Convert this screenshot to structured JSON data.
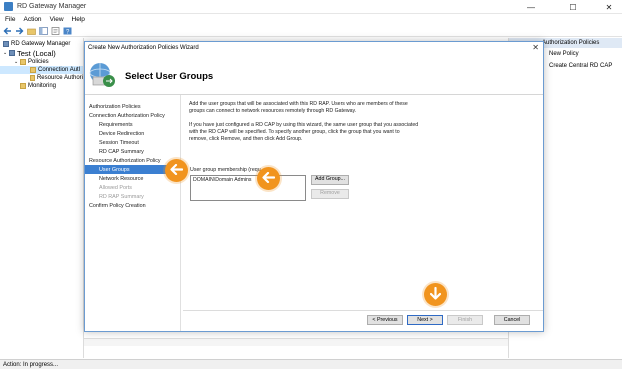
{
  "window": {
    "title": "RD Gateway Manager",
    "controls": {
      "minimize": "—",
      "maximize": "☐",
      "close": "✕"
    }
  },
  "menu": [
    "File",
    "Action",
    "View",
    "Help"
  ],
  "toolbar": [
    "back-icon",
    "forward-icon",
    "up-folder-icon",
    "console-tree-icon",
    "properties-icon",
    "help-icon"
  ],
  "tree": [
    {
      "label": "RD Gateway Manager",
      "level": 0
    },
    {
      "label": "Test (Local)",
      "level": 1
    },
    {
      "label": "Policies",
      "level": 2
    },
    {
      "label": "Connection Autl",
      "level": 3,
      "selected": true
    },
    {
      "label": "Resource Authori",
      "level": 3
    },
    {
      "label": "Monitoring",
      "level": 2
    }
  ],
  "actions": {
    "header": "Authorization Policies",
    "items": [
      "New Policy",
      "Create Central RD CAP"
    ]
  },
  "status": "Action:  In progress...",
  "wizard": {
    "title": "Create New Authorization Policies Wizard",
    "close": "✕",
    "header": "Select User Groups",
    "nav": [
      {
        "label": "Authorization Policies",
        "level": 1
      },
      {
        "label": "Connection Authorization Policy",
        "level": 1
      },
      {
        "label": "Requirements",
        "level": 2
      },
      {
        "label": "Device Redirection",
        "level": 2
      },
      {
        "label": "Session Timeout",
        "level": 2
      },
      {
        "label": "RD CAP Summary",
        "level": 2
      },
      {
        "label": "Resource Authorization Policy",
        "level": 1
      },
      {
        "label": "User Groups",
        "level": 2,
        "active": true
      },
      {
        "label": "Network Resource",
        "level": 2
      },
      {
        "label": "Allowed Ports",
        "level": 2,
        "disabled": true
      },
      {
        "label": "RD RAP Summary",
        "level": 2,
        "disabled": true
      },
      {
        "label": "Confirm Policy Creation",
        "level": 1
      }
    ],
    "para1": "Add the user groups that will be associated with this RD RAP. Users who are members of these groups can connect to network resources remotely through RD Gateway.",
    "para2": "If you have just configured a RD CAP by using this wizard, the same user group that you associated with the RD CAP will be specified. To specify another group, click the group that you want to remove, click Remove, and then click Add Group.",
    "membership_label": "User group membership (requ",
    "membership_value": "DOMAIN\\Domain Admins",
    "add_group": "Add Group...",
    "remove": "Remove",
    "previous": "< Previous",
    "next": "Next >",
    "finish": "Finish",
    "cancel": "Cancel"
  },
  "colors": {
    "hint": "#f1941e",
    "selection": "#3b7fd1",
    "dialog_border": "#6b9bd1"
  },
  "hints": [
    "arrow-left-icon",
    "arrow-left-icon",
    "arrow-down-icon"
  ]
}
